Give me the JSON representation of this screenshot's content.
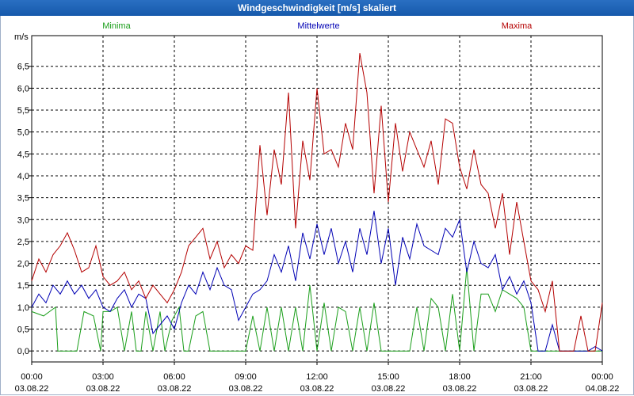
{
  "window": {
    "title": "Windgeschwindigkeit [m/s] skaliert"
  },
  "chart_data": {
    "type": "line",
    "title": "Windgeschwindigkeit [m/s] skaliert",
    "ylabel": "m/s",
    "ylim": [
      -0.25,
      7.2
    ],
    "y_ticks": [
      "0,0",
      "0,5",
      "1,0",
      "1,5",
      "2,0",
      "2,5",
      "3,0",
      "3,5",
      "4,0",
      "4,5",
      "5,0",
      "5,5",
      "6,0",
      "6,5"
    ],
    "x_ticks": [
      {
        "time": "00:00",
        "date": "03.08.22"
      },
      {
        "time": "03:00",
        "date": "03.08.22"
      },
      {
        "time": "06:00",
        "date": "03.08.22"
      },
      {
        "time": "09:00",
        "date": "03.08.22"
      },
      {
        "time": "12:00",
        "date": "03.08.22"
      },
      {
        "time": "15:00",
        "date": "03.08.22"
      },
      {
        "time": "18:00",
        "date": "03.08.22"
      },
      {
        "time": "21:00",
        "date": "03.08.22"
      },
      {
        "time": "00:00",
        "date": "04.08.22"
      }
    ],
    "x_unit": "hours",
    "xlim": [
      0,
      24
    ],
    "grid": true,
    "legend_position": "top",
    "series": [
      {
        "name": "Minima",
        "color": "#1a9e1a",
        "x": [
          0,
          0.5,
          1,
          1.1,
          1.3,
          1.6,
          1.9,
          2.2,
          2.6,
          2.9,
          3,
          3.3,
          3.6,
          3.9,
          4.2,
          4.4,
          4.6,
          4.8,
          5.1,
          5.4,
          5.6,
          5.9,
          6.2,
          6.4,
          6.6,
          6.9,
          7.2,
          7.5,
          7.8,
          8.1,
          8.4,
          8.7,
          9,
          9.3,
          9.6,
          9.9,
          10.2,
          10.5,
          10.8,
          11.1,
          11.4,
          11.7,
          12,
          12.3,
          12.6,
          12.9,
          13.2,
          13.5,
          13.8,
          14.1,
          14.4,
          14.7,
          15,
          15.3,
          15.6,
          15.9,
          16.2,
          16.5,
          16.8,
          17.1,
          17.4,
          17.7,
          18,
          18.3,
          18.6,
          18.9,
          19.2,
          19.5,
          19.8,
          20.1,
          20.4,
          20.7,
          21,
          21.3,
          21.6,
          21.9,
          22.2,
          22.5,
          22.8,
          23.1,
          23.4,
          23.7,
          24
        ],
        "y": [
          0.9,
          0.8,
          1.0,
          0.0,
          0.0,
          0.0,
          0.0,
          0.9,
          0.8,
          0.0,
          0.9,
          0.9,
          1.0,
          0.0,
          0.9,
          0.0,
          0.0,
          0.9,
          0.0,
          0.9,
          0.0,
          0.7,
          1.0,
          0.0,
          0.0,
          0.8,
          0.9,
          0.0,
          0.0,
          0.0,
          0.0,
          0.0,
          0.0,
          0.8,
          0.0,
          1.0,
          0.0,
          1.0,
          0.0,
          1.0,
          0.0,
          1.5,
          0.0,
          1.1,
          0.0,
          1.0,
          0.9,
          0.0,
          1.0,
          0.0,
          1.1,
          0.0,
          0.0,
          0.0,
          0.0,
          0.0,
          1.0,
          0.0,
          1.2,
          1.0,
          0.0,
          1.3,
          0.0,
          1.9,
          0.0,
          1.3,
          1.3,
          0.9,
          1.4,
          1.3,
          1.2,
          1.0,
          0.0,
          0.0,
          0.0,
          0.0,
          0.0,
          0.0,
          0.0,
          0.0,
          0.0,
          0.0,
          0.0
        ]
      },
      {
        "name": "Mittelwerte",
        "color": "#0000b4",
        "x": [
          0,
          0.3,
          0.6,
          0.9,
          1.2,
          1.5,
          1.8,
          2.1,
          2.4,
          2.7,
          3,
          3.3,
          3.6,
          3.9,
          4.2,
          4.5,
          4.8,
          5.1,
          5.4,
          5.7,
          6,
          6.3,
          6.6,
          6.9,
          7.2,
          7.5,
          7.8,
          8.1,
          8.4,
          8.7,
          9,
          9.3,
          9.6,
          9.9,
          10.2,
          10.5,
          10.8,
          11.1,
          11.4,
          11.7,
          12,
          12.3,
          12.6,
          12.9,
          13.2,
          13.5,
          13.8,
          14.1,
          14.4,
          14.7,
          15,
          15.3,
          15.6,
          15.9,
          16.2,
          16.5,
          16.8,
          17.1,
          17.4,
          17.7,
          18,
          18.3,
          18.6,
          18.9,
          19.2,
          19.5,
          19.8,
          20.1,
          20.4,
          20.7,
          21,
          21.3,
          21.6,
          21.9,
          22.2,
          22.5,
          22.8,
          23.1,
          23.4,
          23.7,
          24
        ],
        "y": [
          1.0,
          1.3,
          1.1,
          1.5,
          1.3,
          1.6,
          1.3,
          1.5,
          1.2,
          1.4,
          1.0,
          0.9,
          1.2,
          1.4,
          1.0,
          1.3,
          1.2,
          0.4,
          0.6,
          0.8,
          0.5,
          1.1,
          1.5,
          1.3,
          1.8,
          1.4,
          1.9,
          1.5,
          1.4,
          0.7,
          1.0,
          1.3,
          1.4,
          1.6,
          2.2,
          1.8,
          2.4,
          1.6,
          2.7,
          2.1,
          2.9,
          2.2,
          2.8,
          2.0,
          2.5,
          1.8,
          2.8,
          2.2,
          3.2,
          2.0,
          2.8,
          1.5,
          2.6,
          2.1,
          2.9,
          2.4,
          2.3,
          2.2,
          2.8,
          2.6,
          3.0,
          1.8,
          2.5,
          2.0,
          1.9,
          2.2,
          1.4,
          1.7,
          1.3,
          1.6,
          1.1,
          0.0,
          0.0,
          0.6,
          0.0,
          0.0,
          0.0,
          0.0,
          0.0,
          0.1,
          0.0
        ]
      },
      {
        "name": "Maxima",
        "color": "#b40000",
        "x": [
          0,
          0.3,
          0.6,
          0.9,
          1.2,
          1.5,
          1.8,
          2.1,
          2.4,
          2.7,
          3,
          3.3,
          3.6,
          3.9,
          4.2,
          4.5,
          4.8,
          5.1,
          5.4,
          5.7,
          6,
          6.3,
          6.6,
          6.9,
          7.2,
          7.5,
          7.8,
          8.1,
          8.4,
          8.7,
          9,
          9.3,
          9.6,
          9.9,
          10.2,
          10.5,
          10.8,
          11.1,
          11.4,
          11.7,
          12,
          12.3,
          12.6,
          12.9,
          13.2,
          13.5,
          13.8,
          14.1,
          14.4,
          14.7,
          15,
          15.3,
          15.6,
          15.9,
          16.2,
          16.5,
          16.8,
          17.1,
          17.4,
          17.7,
          18,
          18.3,
          18.6,
          18.9,
          19.2,
          19.5,
          19.8,
          20.1,
          20.4,
          20.7,
          21,
          21.3,
          21.6,
          21.9,
          22.2,
          22.5,
          22.8,
          23.1,
          23.4,
          23.7,
          24
        ],
        "y": [
          1.6,
          2.1,
          1.8,
          2.2,
          2.4,
          2.7,
          2.3,
          1.8,
          1.9,
          2.4,
          1.7,
          1.5,
          1.6,
          1.8,
          1.4,
          1.6,
          1.2,
          1.5,
          1.3,
          1.1,
          1.4,
          1.8,
          2.4,
          2.6,
          2.8,
          2.1,
          2.5,
          1.9,
          2.2,
          2.0,
          2.4,
          2.3,
          4.7,
          3.1,
          4.6,
          3.8,
          5.9,
          2.8,
          4.8,
          3.9,
          6.0,
          4.5,
          4.6,
          4.2,
          5.2,
          4.6,
          6.8,
          5.9,
          3.6,
          5.6,
          3.4,
          5.2,
          4.1,
          5.0,
          4.6,
          4.2,
          4.8,
          3.8,
          5.3,
          5.2,
          4.2,
          3.7,
          4.6,
          3.8,
          3.6,
          2.8,
          3.6,
          2.2,
          3.4,
          2.5,
          1.6,
          1.4,
          0.9,
          1.6,
          0.0,
          0.0,
          0.0,
          0.8,
          0.0,
          0.0,
          1.1
        ]
      }
    ]
  }
}
